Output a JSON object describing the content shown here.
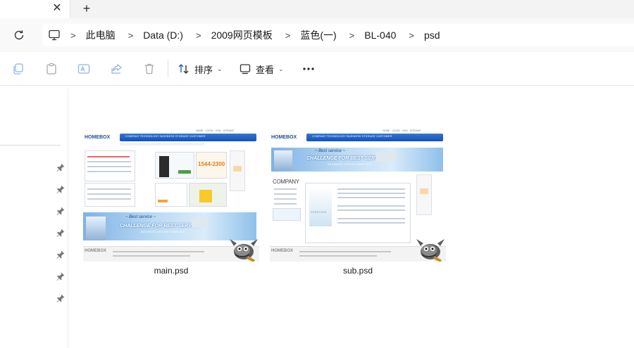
{
  "tabbar": {
    "close_glyph": "✕",
    "new_tab_glyph": "+"
  },
  "address": {
    "breadcrumbs": [
      "此电脑",
      "Data (D:)",
      "2009网页模板",
      "蓝色(一)",
      "BL-040",
      "psd"
    ],
    "separator": ">"
  },
  "toolbar": {
    "sort_label": "排序",
    "view_label": "查看",
    "icons": [
      "copy-icon",
      "paste-icon",
      "rename-icon",
      "share-icon",
      "delete-icon",
      "more-icon"
    ]
  },
  "nav": {
    "pinned_count": 7
  },
  "files": [
    {
      "name": "main.psd",
      "thumb": {
        "logo": "HOMEBOX",
        "nav": "COMPANY   TECHNOLOGY   BUSINESS   STORAGE   CUSTOMER",
        "banner_title": "CHALLENGE FOR BEST SERVICE",
        "banner_sub": "BUSINESS DESIGN TEMPLATE",
        "phone": "1544-2300",
        "footer_logo": "HOMEBOX"
      }
    },
    {
      "name": "sub.psd",
      "thumb": {
        "logo": "HOMEBOX",
        "nav": "COMPANY   TECHNOLOGY   BUSINESS   STORAGE   CUSTOMER",
        "banner_title": "CHALLENGE FOR BEST SERVICE",
        "banner_sub": "BUSINESS DESIGN TEMPLATE",
        "company": "COMPANY",
        "overview": "OVERVIEW",
        "footer_logo": "HOMEBOX"
      }
    }
  ],
  "colors": {
    "accent_blue": "#1a4fb2",
    "banner_light": "#b9d9f3",
    "tabstrip": "#f3f3f3"
  }
}
